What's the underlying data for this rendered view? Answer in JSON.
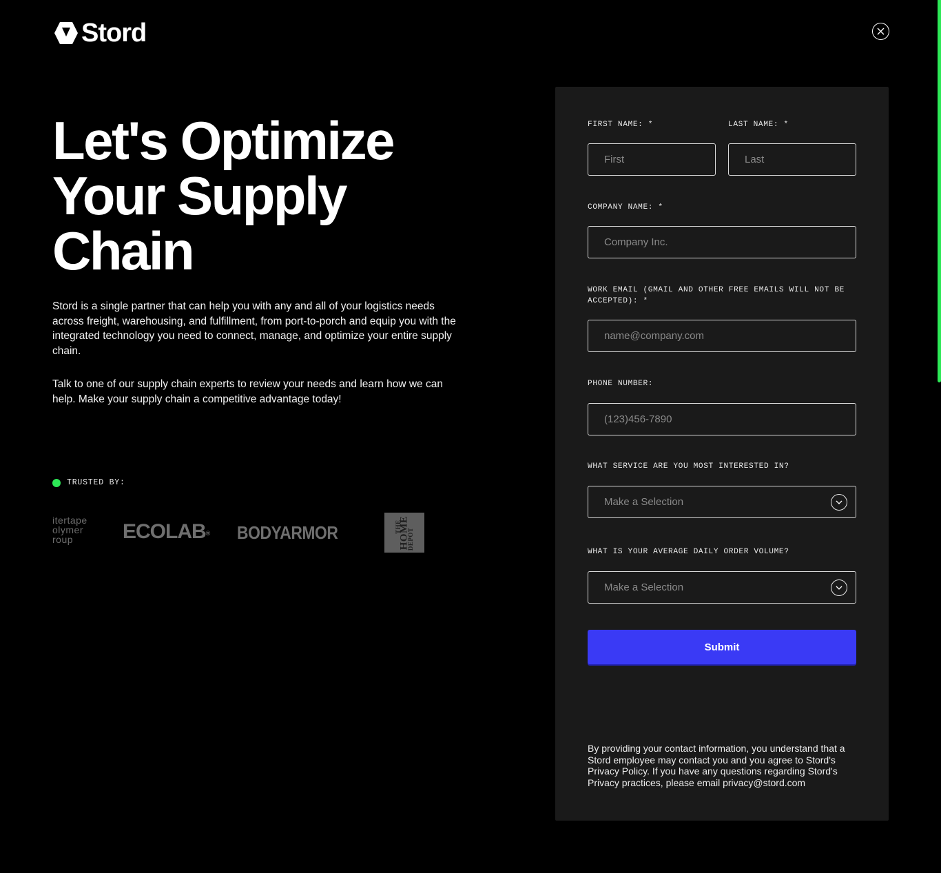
{
  "brand": {
    "name": "Stord",
    "accent": "#2de856",
    "primary_button": "#3a3af5",
    "panel_bg": "#1a1a1a"
  },
  "header": {
    "logo_icon": "stord-hexagon-icon",
    "close_icon": "close-icon"
  },
  "hero": {
    "title": "Let's Optimize Your Supply Chain",
    "paragraph_1": "Stord is a single partner that can help you with any and all of your logistics needs across freight, warehousing, and fulfillment, from port-to-porch and equip you with the integrated technology you need to connect, manage, and optimize your entire supply chain.",
    "paragraph_2": "Talk to one of our supply chain experts to review your needs and learn how we can help. Make your supply chain a competitive advantage today!"
  },
  "trusted": {
    "label": "TRUSTED BY:",
    "logos": {
      "intertape": [
        "itertape",
        "olymer",
        "roup"
      ],
      "ecolab": "ECOLAB",
      "ecolab_mark": "®",
      "bodyarmor": "BODYARMOR",
      "homedepot": [
        "THE",
        "HOME",
        "DEPOT"
      ]
    }
  },
  "form": {
    "first_name": {
      "label": "FIRST NAME: *",
      "placeholder": "First",
      "value": ""
    },
    "last_name": {
      "label": "LAST NAME: *",
      "placeholder": "Last",
      "value": ""
    },
    "company": {
      "label": "COMPANY NAME: *",
      "placeholder": "Company Inc.",
      "value": ""
    },
    "email": {
      "label": "WORK EMAIL (GMAIL AND OTHER FREE EMAILS WILL NOT BE ACCEPTED): *",
      "placeholder": "name@company.com",
      "value": ""
    },
    "phone": {
      "label": "PHONE NUMBER:",
      "placeholder": "(123)456-7890",
      "value": ""
    },
    "service": {
      "label": "WHAT SERVICE ARE YOU MOST INTERESTED IN?",
      "selected": "Make a Selection",
      "icon": "chevron-down-icon"
    },
    "volume": {
      "label": "WHAT IS YOUR AVERAGE DAILY ORDER VOLUME?",
      "selected": "Make a Selection",
      "icon": "chevron-down-icon"
    },
    "submit_label": "Submit",
    "disclaimer": "By providing your contact information, you understand that a Stord employee may contact you and you agree to Stord's Privacy Policy. If you have any questions regarding Stord's Privacy practices, please email privacy@stord.com"
  }
}
